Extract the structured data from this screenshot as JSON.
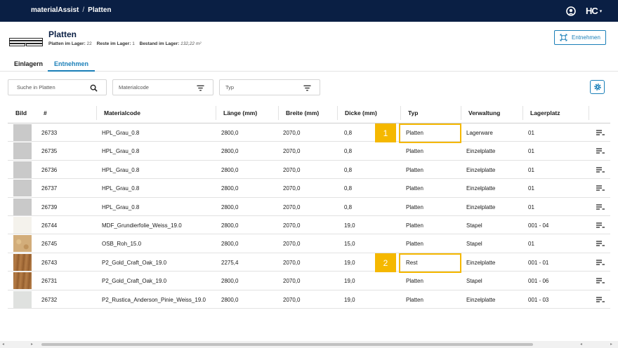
{
  "topbar": {
    "app_name": "materialAssist",
    "separator": "/",
    "section": "Platten",
    "brand": "HC",
    "brand_caret": "▾"
  },
  "header": {
    "title": "Platten",
    "stats": {
      "platten_label": "Platten im Lager:",
      "platten_value": "22",
      "reste_label": "Reste im Lager:",
      "reste_value": "1",
      "bestand_label": "Bestand im Lager:",
      "bestand_value": "132,22 m²"
    },
    "action_button": "Entnehmen"
  },
  "tabs": [
    {
      "label": "Einlagern",
      "active": false
    },
    {
      "label": "Entnehmen",
      "active": true
    }
  ],
  "filters": {
    "search_placeholder": "Suche in Platten",
    "materialcode_placeholder": "Materialcode",
    "typ_placeholder": "Typ"
  },
  "table": {
    "columns": [
      "Bild",
      "#",
      "Materialcode",
      "Länge (mm)",
      "Breite (mm)",
      "Dicke (mm)",
      "Typ",
      "Verwaltung",
      "Lagerplatz"
    ],
    "rows": [
      {
        "thumb": "#c9c9c9",
        "id": "26733",
        "code": "HPL_Grau_0.8",
        "laenge": "2800,0",
        "breite": "2070,0",
        "dicke": "0,8",
        "typ": "Platten",
        "verwaltung": "Lagerware",
        "lagerplatz": "01"
      },
      {
        "thumb": "#c9c9c9",
        "id": "26735",
        "code": "HPL_Grau_0.8",
        "laenge": "2800,0",
        "breite": "2070,0",
        "dicke": "0,8",
        "typ": "Platten",
        "verwaltung": "Einzelplatte",
        "lagerplatz": "01"
      },
      {
        "thumb": "#c9c9c9",
        "id": "26736",
        "code": "HPL_Grau_0.8",
        "laenge": "2800,0",
        "breite": "2070,0",
        "dicke": "0,8",
        "typ": "Platten",
        "verwaltung": "Einzelplatte",
        "lagerplatz": "01"
      },
      {
        "thumb": "#c9c9c9",
        "id": "26737",
        "code": "HPL_Grau_0.8",
        "laenge": "2800,0",
        "breite": "2070,0",
        "dicke": "0,8",
        "typ": "Platten",
        "verwaltung": "Einzelplatte",
        "lagerplatz": "01"
      },
      {
        "thumb": "#c9c9c9",
        "id": "26739",
        "code": "HPL_Grau_0.8",
        "laenge": "2800,0",
        "breite": "2070,0",
        "dicke": "0,8",
        "typ": "Platten",
        "verwaltung": "Einzelplatte",
        "lagerplatz": "01"
      },
      {
        "thumb": "#f4f2ec",
        "id": "26744",
        "code": "MDF_Grundierfolie_Weiss_19.0",
        "laenge": "2800,0",
        "breite": "2070,0",
        "dicke": "19,0",
        "typ": "Platten",
        "verwaltung": "Stapel",
        "lagerplatz": "001 - 04"
      },
      {
        "thumb": "#d2ad7a",
        "id": "26745",
        "code": "OSB_Roh_15.0",
        "laenge": "2800,0",
        "breite": "2070,0",
        "dicke": "15,0",
        "typ": "Platten",
        "verwaltung": "Stapel",
        "lagerplatz": "01"
      },
      {
        "thumb": "#a8703d",
        "id": "26743",
        "code": "P2_Gold_Craft_Oak_19.0",
        "laenge": "2275,4",
        "breite": "2070,0",
        "dicke": "19,0",
        "typ": "Rest",
        "verwaltung": "Einzelplatte",
        "lagerplatz": "001 - 01"
      },
      {
        "thumb": "#a8703d",
        "id": "26731",
        "code": "P2_Gold_Craft_Oak_19.0",
        "laenge": "2800,0",
        "breite": "2070,0",
        "dicke": "19,0",
        "typ": "Platten",
        "verwaltung": "Stapel",
        "lagerplatz": "001 - 06"
      },
      {
        "thumb": "#dfe1df",
        "id": "26732",
        "code": "P2_Rustica_Anderson_Pinie_Weiss_19.0",
        "laenge": "2800,0",
        "breite": "2070,0",
        "dicke": "19,0",
        "typ": "Platten",
        "verwaltung": "Einzelplatte",
        "lagerplatz": "001 - 03"
      }
    ]
  },
  "highlights": [
    {
      "label": "1",
      "row": 0
    },
    {
      "label": "2",
      "row": 7
    }
  ],
  "colors": {
    "topbar": "#0a1f44",
    "accent": "#1a7fb8",
    "highlight": "#f5b800"
  },
  "icons": {
    "user": "user-circle-icon",
    "search": "search-icon",
    "filter": "filter-icon",
    "settings": "gear-icon",
    "row_menu": "row-menu-icon",
    "action": "extract-icon",
    "page": "stacked-boards-icon"
  }
}
